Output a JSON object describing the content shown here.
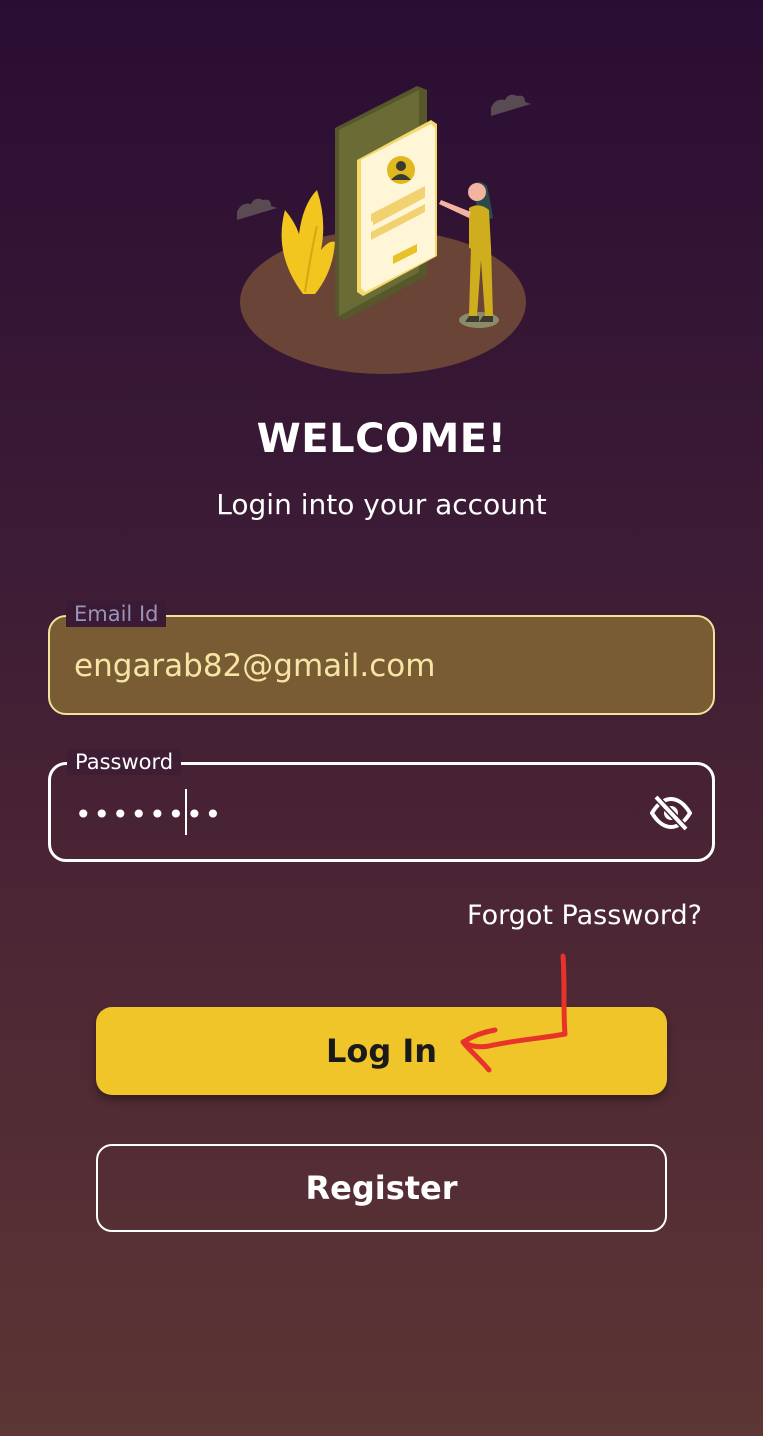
{
  "welcome": {
    "title": "WELCOME!",
    "subtitle": "Login into your account"
  },
  "email": {
    "label": "Email Id",
    "value": "engarab82@gmail.com"
  },
  "password": {
    "label": "Password",
    "masked_value": "••••••••"
  },
  "links": {
    "forgot_password": "Forgot Password?"
  },
  "buttons": {
    "login": "Log In",
    "register": "Register"
  },
  "icons": {
    "password_toggle": "eye-off-icon"
  },
  "colors": {
    "accent": "#efc52a",
    "email_fill": "#7a5c34",
    "annotation": "#e8332a"
  }
}
